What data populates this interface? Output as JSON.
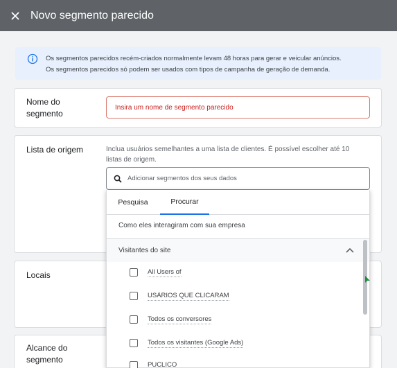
{
  "header": {
    "close_icon": "close-icon",
    "title": "Novo segmento parecido"
  },
  "info": {
    "icon": "info-icon",
    "line1": "Os segmentos parecidos recém-criados normalmente levam 48 horas para gerar e veicular anúncios.",
    "line2": "Os segmentos parecidos só podem ser usados com tipos de campanha de geração de demanda."
  },
  "name_section": {
    "label_line1": "Nome do",
    "label_line2": "segmento",
    "input_placeholder": "Insira um nome de segmento parecido"
  },
  "origin_section": {
    "label": "Lista de origem",
    "description": "Inclua usuários semelhantes a uma lista de clientes. É possível escolher até 10 listas de origem.",
    "search_placeholder": "Adicionar segmentos dos seus dados",
    "tabs": [
      {
        "label": "Pesquisa"
      },
      {
        "label": "Procurar"
      }
    ],
    "interaction_label": "Como eles interagiram com sua empresa",
    "group_label": "Visitantes do site",
    "items": [
      {
        "label": "All Users of",
        "checked": false
      },
      {
        "label": "USÁRIOS QUE CLICARAM",
        "checked": false
      },
      {
        "label": "Todos os conversores",
        "checked": false
      },
      {
        "label": "Todos os visitantes (Google Ads)",
        "checked": false
      },
      {
        "label": "PUCLICO",
        "checked": false
      }
    ]
  },
  "locais_section": {
    "label": "Locais"
  },
  "alcance_section": {
    "label_line1": "Alcance do",
    "label_line2": "segmento"
  },
  "colors": {
    "topbar": "#5f6368",
    "banner": "#e8f0fe",
    "accent": "#1a73e8",
    "error": "#c5221f"
  }
}
